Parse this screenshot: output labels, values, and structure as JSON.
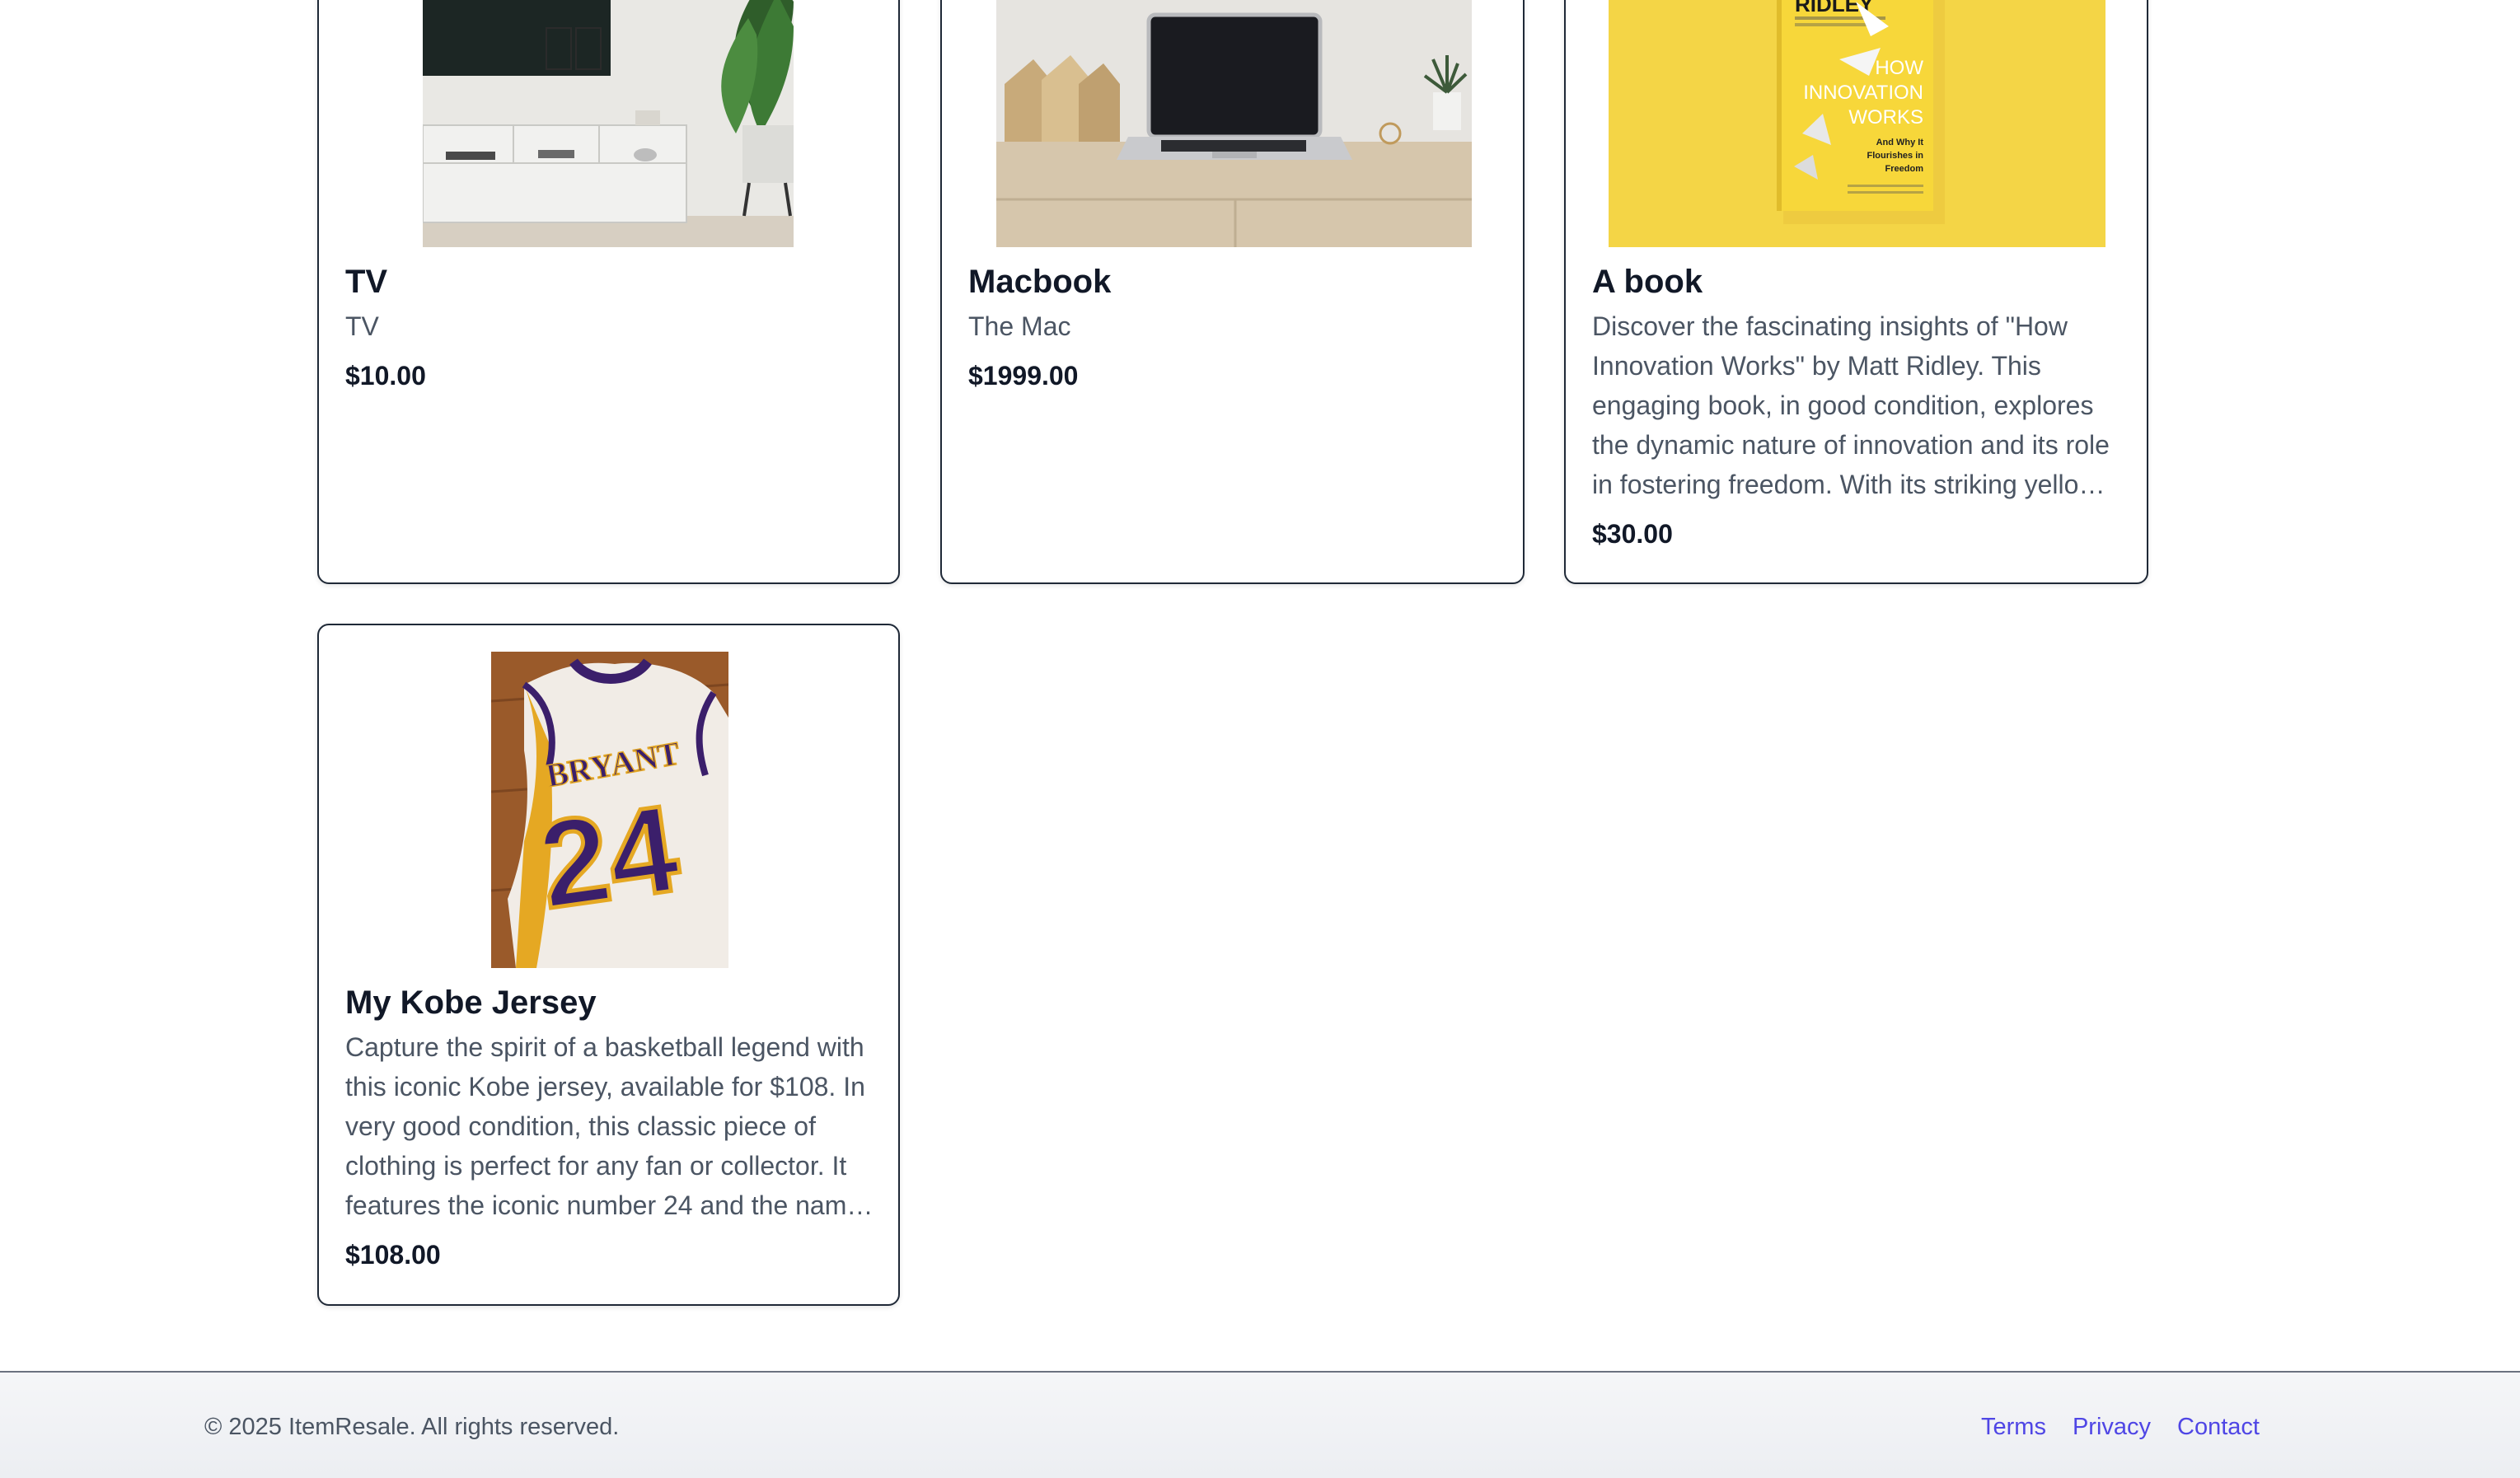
{
  "products": [
    {
      "title": "TV",
      "description": "TV",
      "price": "$10.00"
    },
    {
      "title": "Macbook",
      "description": "The Mac",
      "price": "$1999.00"
    },
    {
      "title": "A book",
      "description": "Discover the fascinating insights of \"How Innovation Works\" by Matt Ridley. This engaging book, in good condition, explores the dynamic nature of innovation and its role in fostering freedom. With its striking yellow cover and vivid illustrations, it is a must-read for curious minds.",
      "price": "$30.00",
      "cover": {
        "author": "RIDLEY",
        "title_line1": "HOW",
        "title_line2": "INNOVATION",
        "title_line3": "WORKS",
        "subtitle_line1": "And Why It",
        "subtitle_line2": "Flourishes in",
        "subtitle_line3": "Freedom"
      }
    },
    {
      "title": "My Kobe Jersey",
      "description": "Capture the spirit of a basketball legend with this iconic Kobe jersey, available for $108. In very good condition, this classic piece of clothing is perfect for any fan or collector. It features the iconic number 24 and the name Bryant across the back.",
      "price": "$108.00",
      "jersey": {
        "name": "BRYANT",
        "number": "24"
      }
    }
  ],
  "footer": {
    "copyright": "© 2025 ItemResale. All rights reserved.",
    "links": [
      "Terms",
      "Privacy",
      "Contact"
    ]
  },
  "colors": {
    "link": "#4f46e5",
    "card_border": "#1f2937",
    "book_cover": "#f4d546",
    "jersey_purple": "#3b1f6b",
    "jersey_gold": "#e5a823"
  }
}
